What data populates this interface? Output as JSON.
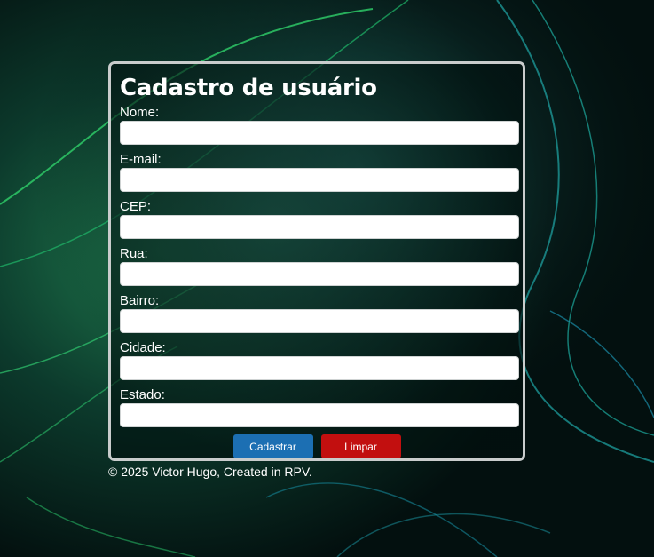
{
  "form": {
    "title": "Cadastro de usuário",
    "fields": [
      {
        "label": "Nome:",
        "value": ""
      },
      {
        "label": "E-mail:",
        "value": ""
      },
      {
        "label": "CEP:",
        "value": ""
      },
      {
        "label": "Rua:",
        "value": ""
      },
      {
        "label": "Bairro:",
        "value": ""
      },
      {
        "label": "Cidade:",
        "value": ""
      },
      {
        "label": "Estado:",
        "value": ""
      }
    ],
    "submit_label": "Cadastrar",
    "clear_label": "Limpar"
  },
  "footer": {
    "text": "© 2025 Victor Hugo, Created in RPV."
  },
  "colors": {
    "submit": "#1c6fb3",
    "clear": "#c20f0f",
    "card_border": "#c9cccc",
    "background": "#04191a"
  }
}
